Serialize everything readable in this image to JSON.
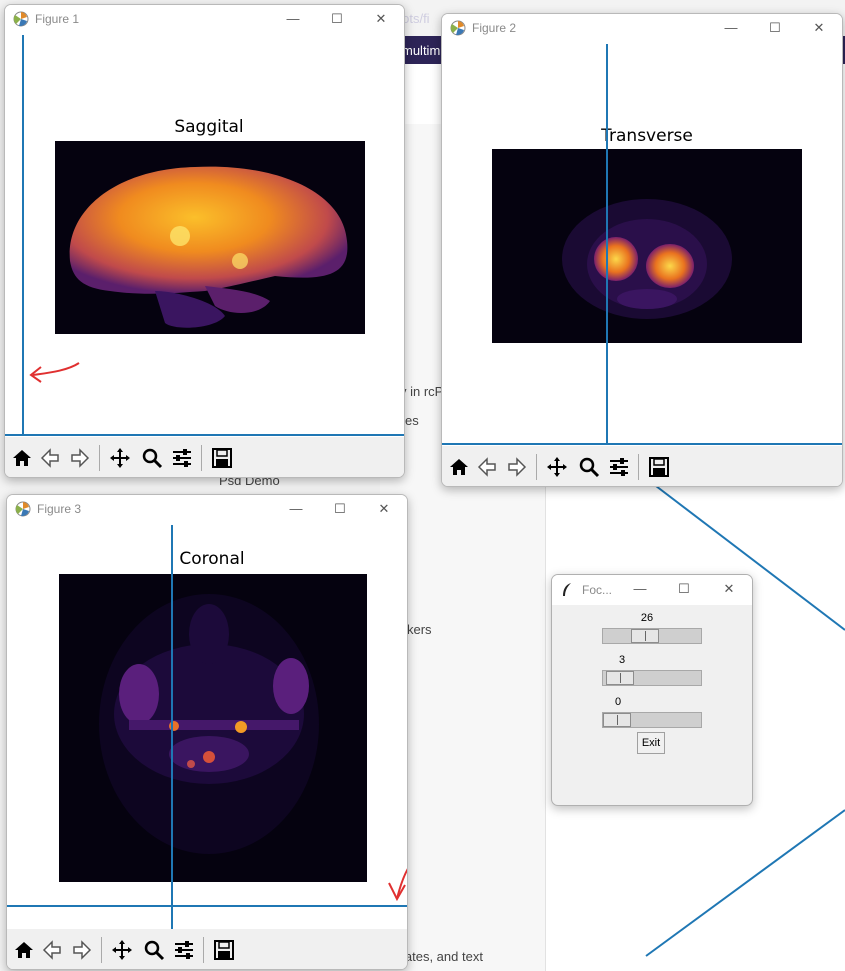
{
  "background": {
    "url_fragment": "plots/fi",
    "tab_fragment": "multim",
    "items": [
      "y in rcP",
      "es",
      "Psd Demo",
      "kers",
      "lates, and text"
    ]
  },
  "figure1": {
    "title": "Figure 1",
    "plot_title": "Saggital",
    "cursor_color": "#1f77b4"
  },
  "figure2": {
    "title": "Figure 2",
    "plot_title": "Transverse",
    "cursor_color": "#1f77b4"
  },
  "figure3": {
    "title": "Figure 3",
    "plot_title": "Coronal",
    "cursor_color": "#1f77b4"
  },
  "toolbar_icons": [
    "home-icon",
    "back-icon",
    "forward-icon",
    "pan-icon",
    "zoom-icon",
    "configure-icon",
    "save-icon"
  ],
  "controls": {
    "title": "Foc...",
    "slider1_value": "26",
    "slider2_value": "3",
    "slider3_value": "0",
    "exit_label": "Exit"
  },
  "annotation_color": "#e03030",
  "colormap": "inferno"
}
